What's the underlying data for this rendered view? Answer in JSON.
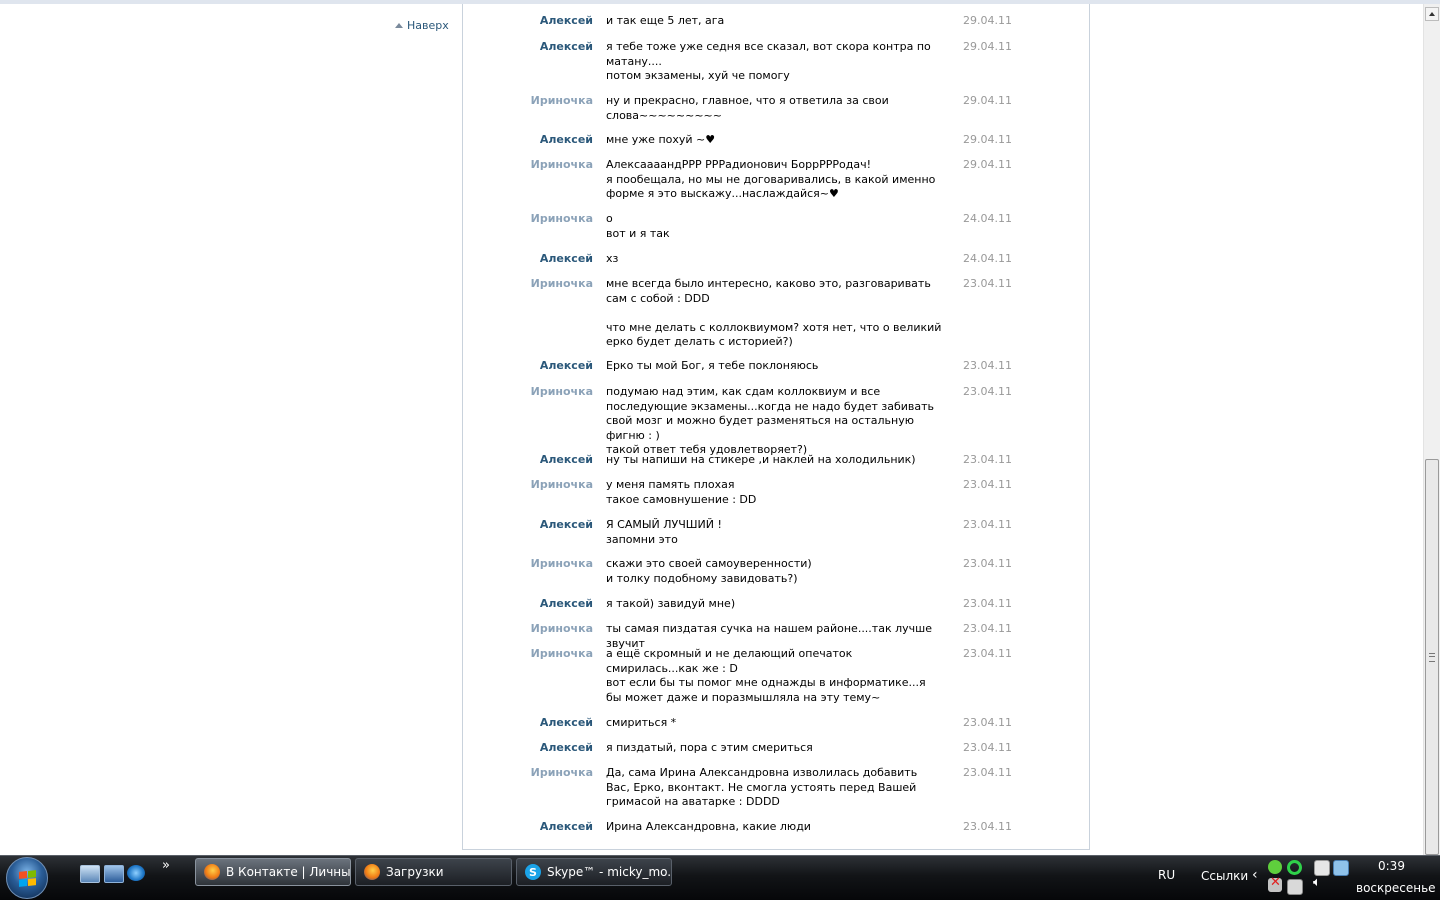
{
  "back_to_top": "Наверх",
  "messages": [
    {
      "author": "Алексей",
      "who": "alexey",
      "text": "и так еще 5 лет, ага",
      "date": "29.04.11"
    },
    {
      "author": "Алексей",
      "who": "alexey",
      "text": "я тебе тоже уже седня все сказал, вот скора контра по матану....\nпотом экзамены, хуй че помогу",
      "date": "29.04.11"
    },
    {
      "author": "Ириночка",
      "who": "irina",
      "text": "ну и прекрасно, главное, что я ответила за свои слова~~~~~~~~~",
      "date": "29.04.11"
    },
    {
      "author": "Алексей",
      "who": "alexey",
      "text": "мне уже похуй ~♥",
      "date": "29.04.11"
    },
    {
      "author": "Ириночка",
      "who": "irina",
      "text": "АлексаааандРРР РРРадионович БоррРРРодач!\nя пообещала, но мы не договаривались, в какой именно форме я это выскажу...наслаждайся~♥",
      "date": "29.04.11"
    },
    {
      "author": "Ириночка",
      "who": "irina",
      "text": "о\nвот и я так",
      "date": "24.04.11"
    },
    {
      "author": "Алексей",
      "who": "alexey",
      "text": "хз",
      "date": "24.04.11"
    },
    {
      "author": "Ириночка",
      "who": "irina",
      "text": "мне всегда было интересно, каково это, разговаривать сам с собой : DDD\n\nчто мне делать с коллоквиумом? хотя нет, что о великий ерко будет делать с историей?)",
      "date": "23.04.11"
    },
    {
      "author": "Алексей",
      "who": "alexey",
      "text": "Ерко ты мой Бог, я тебе поклоняюсь",
      "date": "23.04.11"
    },
    {
      "author": "Ириночка",
      "who": "irina",
      "text": "подумаю над этим, как сдам коллоквиум и все последующие экзамены...когда не надо будет забивать свой мозг и можно будет разменяться на остальную фигню : )\nтакой ответ тебя удовлетворяет?)",
      "date": "23.04.11"
    },
    {
      "author": "Алексей",
      "who": "alexey",
      "text": "ну ты напиши на стикере ,и наклей на холодильник)",
      "date": "23.04.11"
    },
    {
      "author": "Ириночка",
      "who": "irina",
      "text": "у меня память плохая\nтакое самовнушение : DD",
      "date": "23.04.11"
    },
    {
      "author": "Алексей",
      "who": "alexey",
      "text": "Я САМЫЙ ЛУЧШИЙ !\nзапомни это",
      "date": "23.04.11"
    },
    {
      "author": "Ириночка",
      "who": "irina",
      "text": "скажи это своей самоуверенности)\nи толку подобному завидовать?)",
      "date": "23.04.11"
    },
    {
      "author": "Алексей",
      "who": "alexey",
      "text": "я такой) завидуй мне)",
      "date": "23.04.11"
    },
    {
      "author": "Ириночка",
      "who": "irina",
      "text": "ты самая пиздатая сучка на нашем районе....так лучше звучит",
      "date": "23.04.11"
    },
    {
      "author": "Ириночка",
      "who": "irina",
      "text": "а ещё скромный и не делающий опечаток\nсмирилась...как же : D\nвот если бы ты помог мне однажды в информатике...я бы может даже и поразмышляла на эту тему~",
      "date": "23.04.11"
    },
    {
      "author": "Алексей",
      "who": "alexey",
      "text": "смириться *",
      "date": "23.04.11"
    },
    {
      "author": "Алексей",
      "who": "alexey",
      "text": "я пиздатый, пора с этим смериться",
      "date": "23.04.11"
    },
    {
      "author": "Ириночка",
      "who": "irina",
      "text": "Да, сама Ирина Александровна изволилась добавить Вас, Ерко, вконтакт. Не смогла устоять перед Вашей гримасой на аватарке : DDDD",
      "date": "23.04.11"
    },
    {
      "author": "Алексей",
      "who": "alexey",
      "text": "Ирина Александровна, какие люди",
      "date": "23.04.11"
    }
  ],
  "taskbar": {
    "buttons": [
      {
        "label": "В Контакте | Личны...",
        "icon": "firefox-icon",
        "active": true
      },
      {
        "label": "Загрузки",
        "icon": "firefox-icon",
        "active": false
      },
      {
        "label": "Skype™ - micky_mo...",
        "icon": "skype-icon",
        "active": false
      }
    ],
    "language": "RU",
    "links_label": "Ссылки",
    "time": "0:39",
    "day": "воскресенье",
    "quick_launch_more": "»",
    "tray_expand": "‹"
  },
  "colors": {
    "author_alexey": "#2b587a",
    "author_irina": "#8ba2b8",
    "date": "#999999",
    "taskbar": "#121417"
  }
}
